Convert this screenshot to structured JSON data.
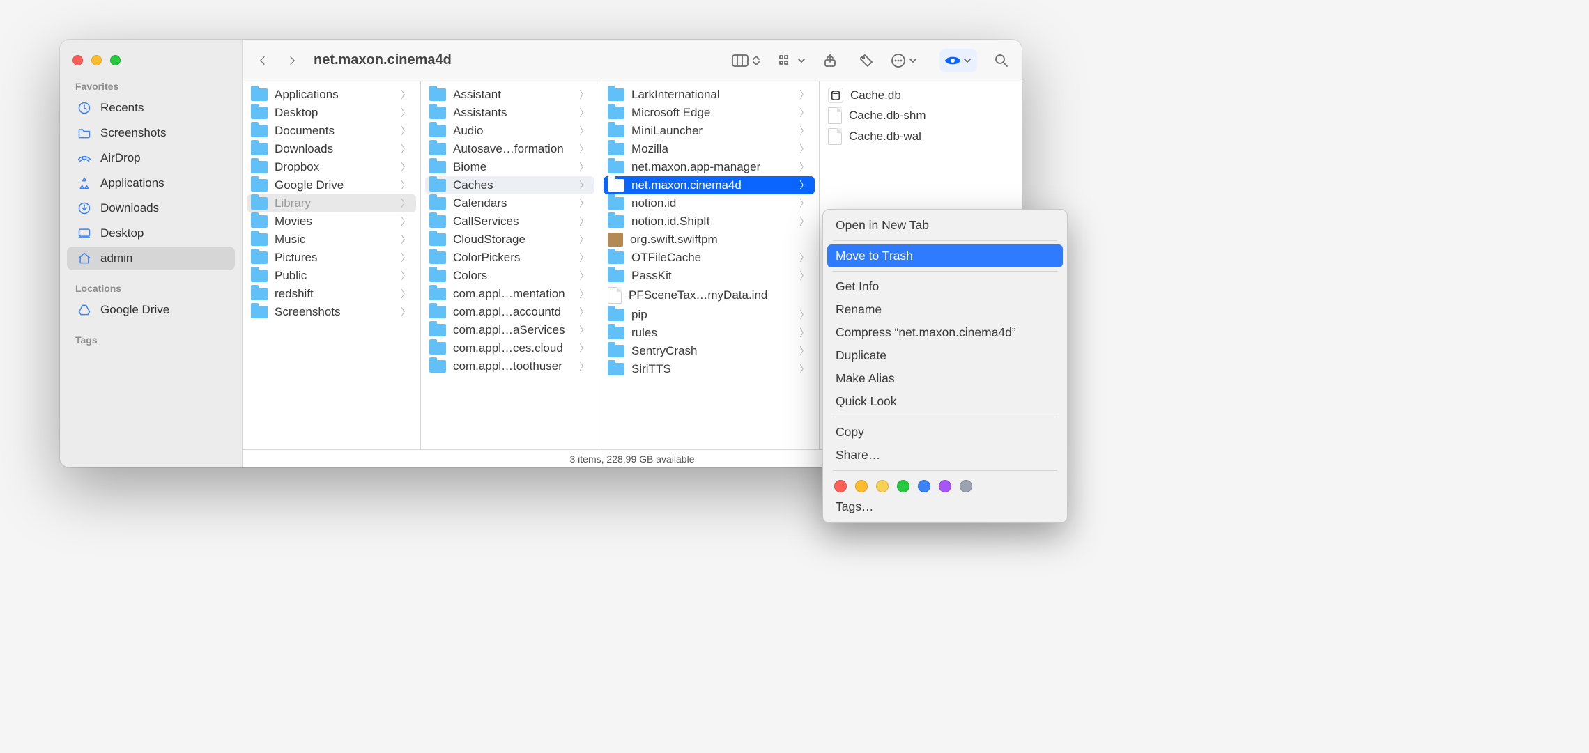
{
  "window": {
    "title": "net.maxon.cinema4d"
  },
  "sidebar": {
    "sections": {
      "favorites": {
        "label": "Favorites",
        "items": [
          {
            "icon": "clock-icon",
            "label": "Recents"
          },
          {
            "icon": "folder-icon",
            "label": "Screenshots"
          },
          {
            "icon": "airdrop-icon",
            "label": "AirDrop"
          },
          {
            "icon": "apps-icon",
            "label": "Applications"
          },
          {
            "icon": "download-icon",
            "label": "Downloads"
          },
          {
            "icon": "desktop-icon",
            "label": "Desktop"
          },
          {
            "icon": "home-icon",
            "label": "admin",
            "selected": true
          }
        ]
      },
      "locations": {
        "label": "Locations",
        "items": [
          {
            "icon": "gdrive-icon",
            "label": "Google Drive"
          }
        ]
      },
      "tags": {
        "label": "Tags"
      }
    }
  },
  "columns": {
    "col1": [
      {
        "type": "folder",
        "label": "Applications"
      },
      {
        "type": "folder",
        "label": "Desktop"
      },
      {
        "type": "folder",
        "label": "Documents"
      },
      {
        "type": "folder",
        "label": "Downloads"
      },
      {
        "type": "folder",
        "label": "Dropbox"
      },
      {
        "type": "folder",
        "label": "Google Drive"
      },
      {
        "type": "folder",
        "label": "Library",
        "state": "grey"
      },
      {
        "type": "folder",
        "label": "Movies"
      },
      {
        "type": "folder",
        "label": "Music"
      },
      {
        "type": "folder",
        "label": "Pictures"
      },
      {
        "type": "folder",
        "label": "Public"
      },
      {
        "type": "folder",
        "label": "redshift"
      },
      {
        "type": "folder",
        "label": "Screenshots"
      }
    ],
    "col2": [
      {
        "type": "folder",
        "label": "Assistant"
      },
      {
        "type": "folder",
        "label": "Assistants"
      },
      {
        "type": "folder",
        "label": "Audio"
      },
      {
        "type": "folder",
        "label": "Autosave…formation"
      },
      {
        "type": "folder",
        "label": "Biome"
      },
      {
        "type": "folder",
        "label": "Caches",
        "state": "hl"
      },
      {
        "type": "folder",
        "label": "Calendars"
      },
      {
        "type": "folder",
        "label": "CallServices"
      },
      {
        "type": "folder",
        "label": "CloudStorage"
      },
      {
        "type": "folder",
        "label": "ColorPickers"
      },
      {
        "type": "folder",
        "label": "Colors"
      },
      {
        "type": "folder",
        "label": "com.appl…mentation"
      },
      {
        "type": "folder",
        "label": "com.appl…accountd"
      },
      {
        "type": "folder",
        "label": "com.appl…aServices"
      },
      {
        "type": "folder",
        "label": "com.appl…ces.cloud"
      },
      {
        "type": "folder",
        "label": "com.appl…toothuser"
      }
    ],
    "col3": [
      {
        "type": "folder",
        "label": "LarkInternational"
      },
      {
        "type": "folder",
        "label": "Microsoft Edge"
      },
      {
        "type": "folder",
        "label": "MiniLauncher"
      },
      {
        "type": "folder",
        "label": "Mozilla"
      },
      {
        "type": "folder",
        "label": "net.maxon.app-manager"
      },
      {
        "type": "folder",
        "label": "net.maxon.cinema4d",
        "state": "blue"
      },
      {
        "type": "folder",
        "label": "notion.id"
      },
      {
        "type": "folder",
        "label": "notion.id.ShipIt"
      },
      {
        "type": "pkg",
        "label": "org.swift.swiftpm"
      },
      {
        "type": "folder",
        "label": "OTFileCache"
      },
      {
        "type": "folder",
        "label": "PassKit"
      },
      {
        "type": "file",
        "label": "PFSceneTax…myData.ind"
      },
      {
        "type": "folder",
        "label": "pip"
      },
      {
        "type": "folder",
        "label": "rules"
      },
      {
        "type": "folder",
        "label": "SentryCrash"
      },
      {
        "type": "folder",
        "label": "SiriTTS"
      }
    ],
    "col4": [
      {
        "type": "db",
        "label": "Cache.db"
      },
      {
        "type": "file",
        "label": "Cache.db-shm"
      },
      {
        "type": "file",
        "label": "Cache.db-wal"
      }
    ]
  },
  "statusbar": "3 items, 228,99 GB available",
  "context_menu": {
    "items": [
      {
        "label": "Open in New Tab"
      },
      {
        "sep": true
      },
      {
        "label": "Move to Trash",
        "selected": true
      },
      {
        "sep": true
      },
      {
        "label": "Get Info"
      },
      {
        "label": "Rename"
      },
      {
        "label": "Compress “net.maxon.cinema4d”"
      },
      {
        "label": "Duplicate"
      },
      {
        "label": "Make Alias"
      },
      {
        "label": "Quick Look"
      },
      {
        "sep": true
      },
      {
        "label": "Copy"
      },
      {
        "label": "Share…"
      },
      {
        "sep": true
      },
      {
        "tags": true
      },
      {
        "label": "Tags…"
      }
    ]
  },
  "toolbar_icons": {
    "back": "back-icon",
    "forward": "forward-icon",
    "columns_view": "columns-view-icon",
    "group": "group-icon",
    "share": "share-icon",
    "tags": "tag-icon",
    "more": "ellipsis-icon",
    "preview": "preview-icon",
    "search": "search-icon"
  }
}
